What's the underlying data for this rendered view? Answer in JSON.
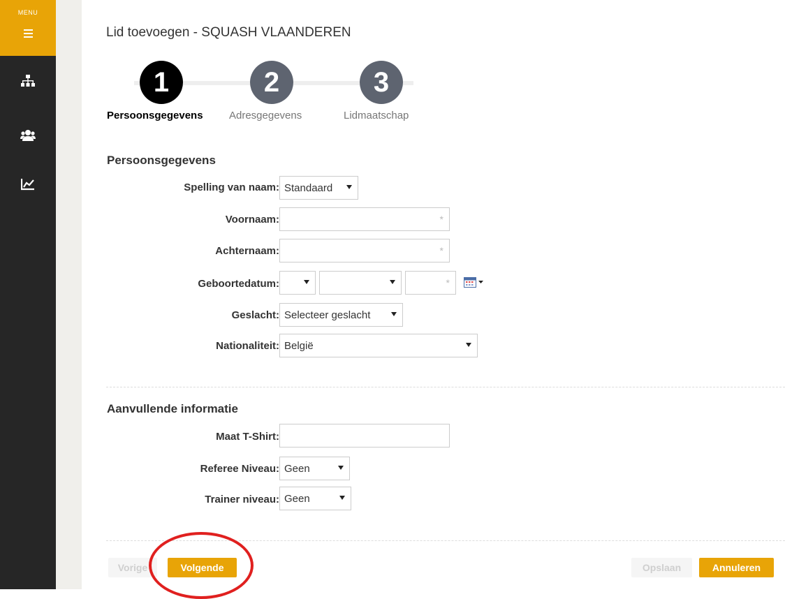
{
  "sidebar": {
    "menu_label": "MENU",
    "items": [
      {
        "icon": "sitemap-icon"
      },
      {
        "icon": "users-icon"
      },
      {
        "icon": "chart-icon"
      }
    ]
  },
  "page": {
    "title": "Lid toevoegen - SQUASH VLAANDEREN"
  },
  "steps": [
    {
      "number": "1",
      "label": "Persoonsgegevens",
      "active": true
    },
    {
      "number": "2",
      "label": "Adresgegevens",
      "active": false
    },
    {
      "number": "3",
      "label": "Lidmaatschap",
      "active": false
    }
  ],
  "personal": {
    "section_title": "Persoonsgegevens",
    "spelling_label": "Spelling van naam:",
    "spelling_value": "Standaard",
    "firstname_label": "Voornaam:",
    "firstname_value": "",
    "lastname_label": "Achternaam:",
    "lastname_value": "",
    "birthdate_label": "Geboortedatum:",
    "birthdate_day": "",
    "birthdate_month": "",
    "birthdate_year": "",
    "gender_label": "Geslacht:",
    "gender_value": "Selecteer geslacht",
    "nationality_label": "Nationaliteit:",
    "nationality_value": "België",
    "required_mark": "*"
  },
  "extra": {
    "section_title": "Aanvullende informatie",
    "tshirt_label": "Maat T-Shirt:",
    "tshirt_value": "",
    "referee_label": "Referee Niveau:",
    "referee_value": "Geen",
    "trainer_label": "Trainer niveau:",
    "trainer_value": "Geen"
  },
  "footer": {
    "prev_label": "Vorige",
    "next_label": "Volgende",
    "save_label": "Opslaan",
    "cancel_label": "Annuleren"
  },
  "colors": {
    "accent": "#e8a407",
    "sidebar": "#262626",
    "step_active": "#000000",
    "step_inactive": "#5e6470",
    "highlight": "#e0201f"
  }
}
